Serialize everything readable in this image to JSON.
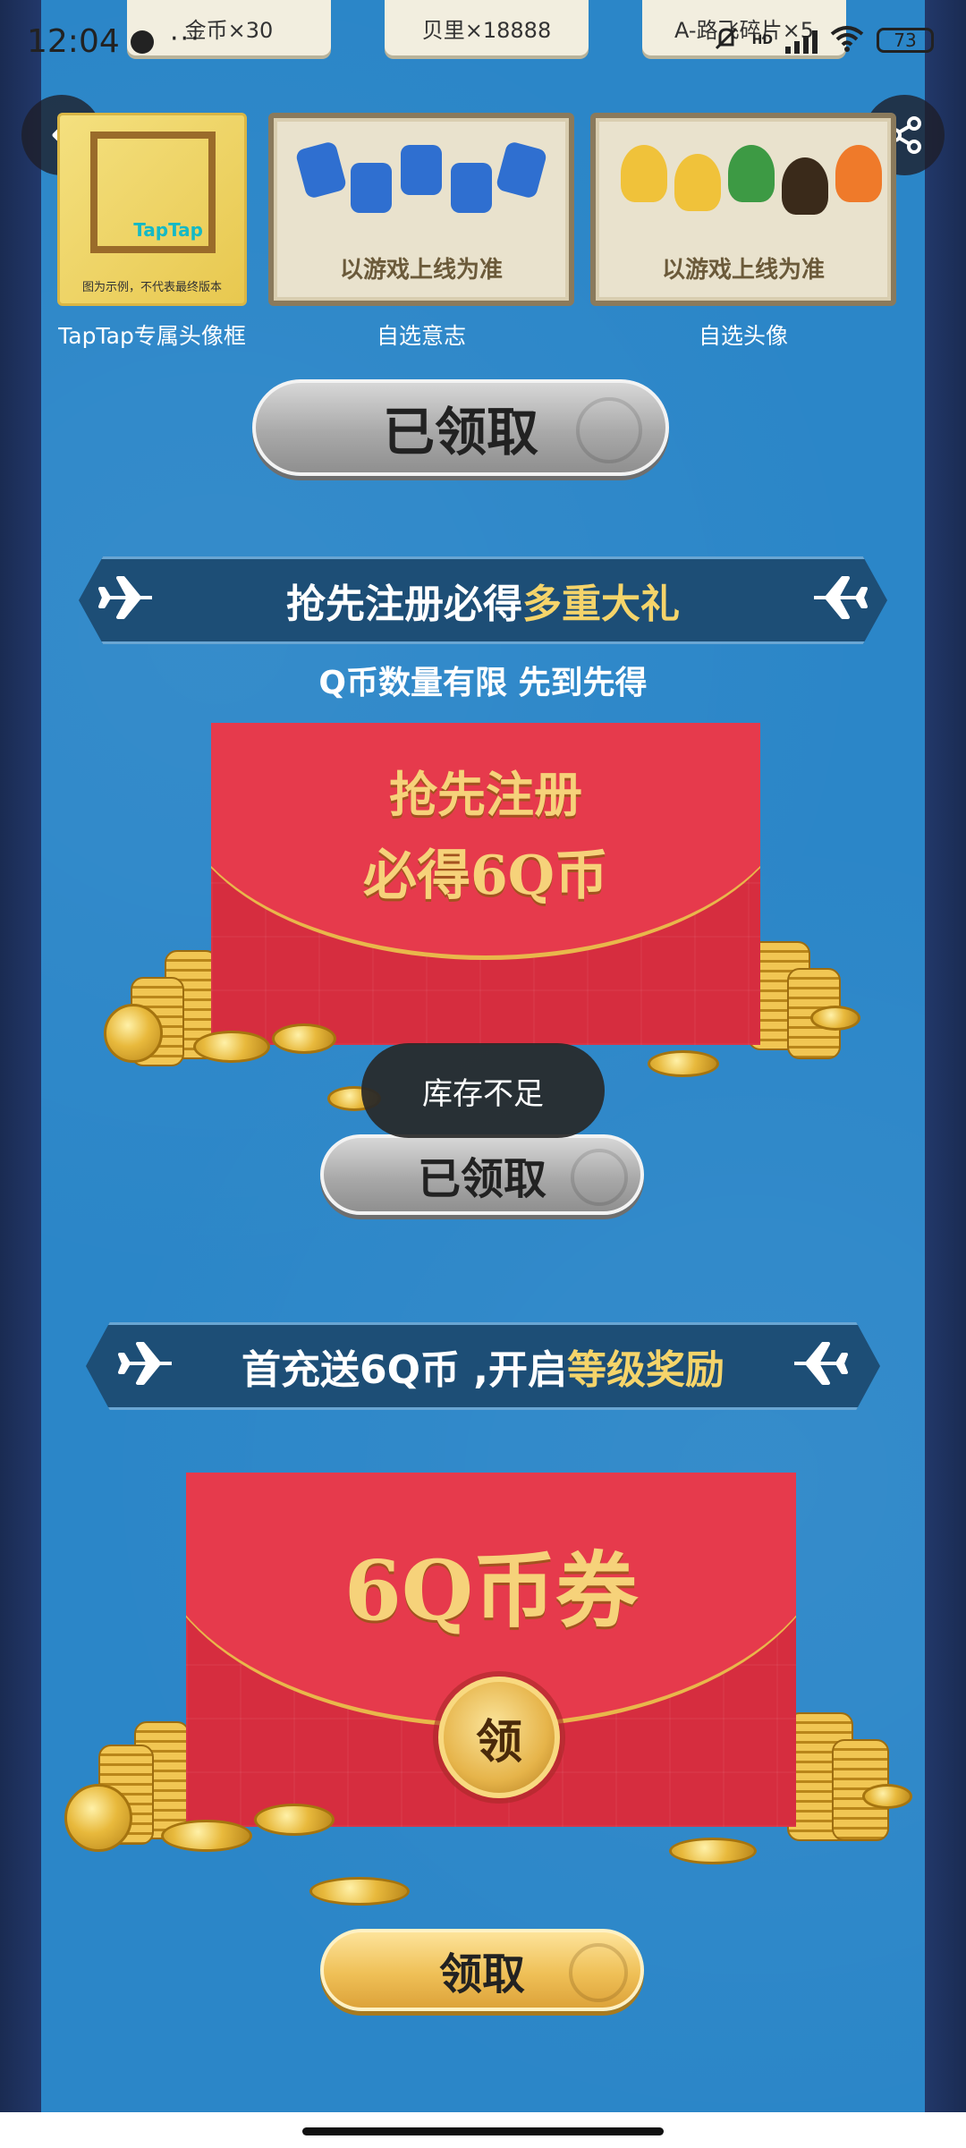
{
  "status_bar": {
    "time": "12:04",
    "more": "···",
    "network": "HD",
    "battery": "73"
  },
  "top_rewards": [
    "金币×30",
    "贝里×18888",
    "A-路飞碎片×5"
  ],
  "reward_cards": [
    {
      "caption": "TapTap专属头像框",
      "brand": "TapTap",
      "note": "图为示例，不代表最终版本"
    },
    {
      "caption": "自选意志",
      "note": "以游戏上线为准"
    },
    {
      "caption": "自选头像",
      "note": "以游戏上线为准"
    }
  ],
  "buttons": {
    "claimed_1": "已领取",
    "claimed_2": "已领取",
    "claim": "领取"
  },
  "section_register": {
    "title_main": "抢先注册必得",
    "title_highlight": "多重大礼",
    "subtitle": "Q币数量有限 先到先得",
    "envelope_line1": "抢先注册",
    "envelope_line2": "必得6Q币"
  },
  "section_recharge": {
    "title_main": "首充送6Q币 ,开启",
    "title_highlight": "等级奖励",
    "envelope_text": "6Q币券",
    "badge": "领"
  },
  "toast": "库存不足",
  "colors": {
    "panel_blue": "#2b86c8",
    "banner_navy": "#1d4e76",
    "highlight_gold": "#f5d46a",
    "envelope_red": "#d62d3f"
  }
}
